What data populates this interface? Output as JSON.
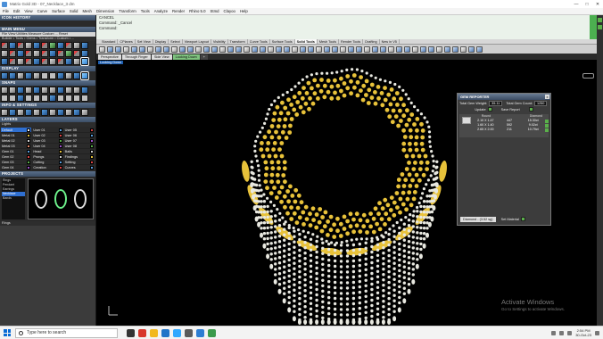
{
  "window": {
    "title": "Matrix Gold 3D - 07_Necklace_3 dm",
    "controls": [
      "—",
      "□",
      "✕"
    ]
  },
  "menu": [
    "File",
    "Edit",
    "View",
    "Curve",
    "Surface",
    "Solid",
    "Mesh",
    "Dimension",
    "Transform",
    "Tools",
    "Analyze",
    "Render",
    "Rhino 5.0",
    "Stmd",
    "Clayoo",
    "Help"
  ],
  "left": {
    "icon_history": "ICON HISTORY",
    "main_menu": "MAIN MENU",
    "main_menu_bar": "File  View  Utilities  Measure  Custom  ...  Reset",
    "builder_bar": "Builder • Tools • Gems • Transform • Custom • ...",
    "display": "DISPLAY",
    "snaps": "SNAPS",
    "info_settings": "INFO & SETTINGS",
    "layers": "LAYERS",
    "layer_tools": "Lights",
    "layers_col1": [
      "Default",
      "Metal 01",
      "Metal 02",
      "Metal 03",
      "Gem 01",
      "Gem 02",
      "Gem 03",
      "Gem 04"
    ],
    "layers_col2": [
      "User 01",
      "User 02",
      "User 03",
      "User 04",
      "Head",
      "Prongs",
      "Cutting",
      "Creation"
    ],
    "layers_col3": [
      "User 05",
      "User 06",
      "User 07",
      "User 08",
      "Bails",
      "Findings",
      "Setting",
      "Curves"
    ],
    "projects": "PROJECTS",
    "project_items": [
      "Rings",
      "Pendant",
      "Earrings",
      "Necklace",
      "Bands"
    ],
    "project_footer": "Rings"
  },
  "command": {
    "line1": "CANCEL",
    "line2": "Command: _Cancel",
    "line3": "Command:"
  },
  "tabs": [
    "Standard",
    "CPlanes",
    "Set View",
    "Display",
    "Select",
    "Viewport Layout",
    "Visibility",
    "Transform",
    "Curve Tools",
    "Surface Tools",
    "Solid Tools",
    "Mesh Tools",
    "Render Tools",
    "Drafting",
    "New in V5"
  ],
  "active_tab_index": 10,
  "view_tabs": [
    "Perspective",
    "Through Finger",
    "Side View",
    "Looking Down",
    "+"
  ],
  "active_view_index": 3,
  "viewport_label": "Looking Down",
  "gem_reporter": {
    "title": "GEM REPORTER",
    "close": "x",
    "total_weight_label": "Total Gem Weight:",
    "total_weight_value": "35.11",
    "total_count_label": "Total Gem Count:",
    "total_count_value": "1250",
    "update_label": "Update",
    "save_report_label": "Save Report",
    "col_size": "Round",
    "col_count": "Diamond",
    "rows": [
      {
        "size": "2.10 X 1.47",
        "count": "447",
        "weight": "15.30ct"
      },
      {
        "size": "1.60 X 1.40",
        "count": "592",
        "weight": "9.02ct"
      },
      {
        "size": "2.65 X 2.00",
        "count": "211",
        "weight": "10.79ct"
      }
    ],
    "material": "Diamond - (3.52 sg)",
    "set_material": "Set Material"
  },
  "watermark": {
    "title": "Activate Windows",
    "subtitle": "Go to Settings to activate Windows."
  },
  "taskbar": {
    "search_placeholder": "Type here to search",
    "time": "2:54 PM",
    "date": "30-Oct-23"
  },
  "colors": {
    "gold": "#e8c23a",
    "gem_white": "#e8e8e0",
    "accent_green": "#4caf50",
    "accent_blue": "#2f6fd0"
  }
}
